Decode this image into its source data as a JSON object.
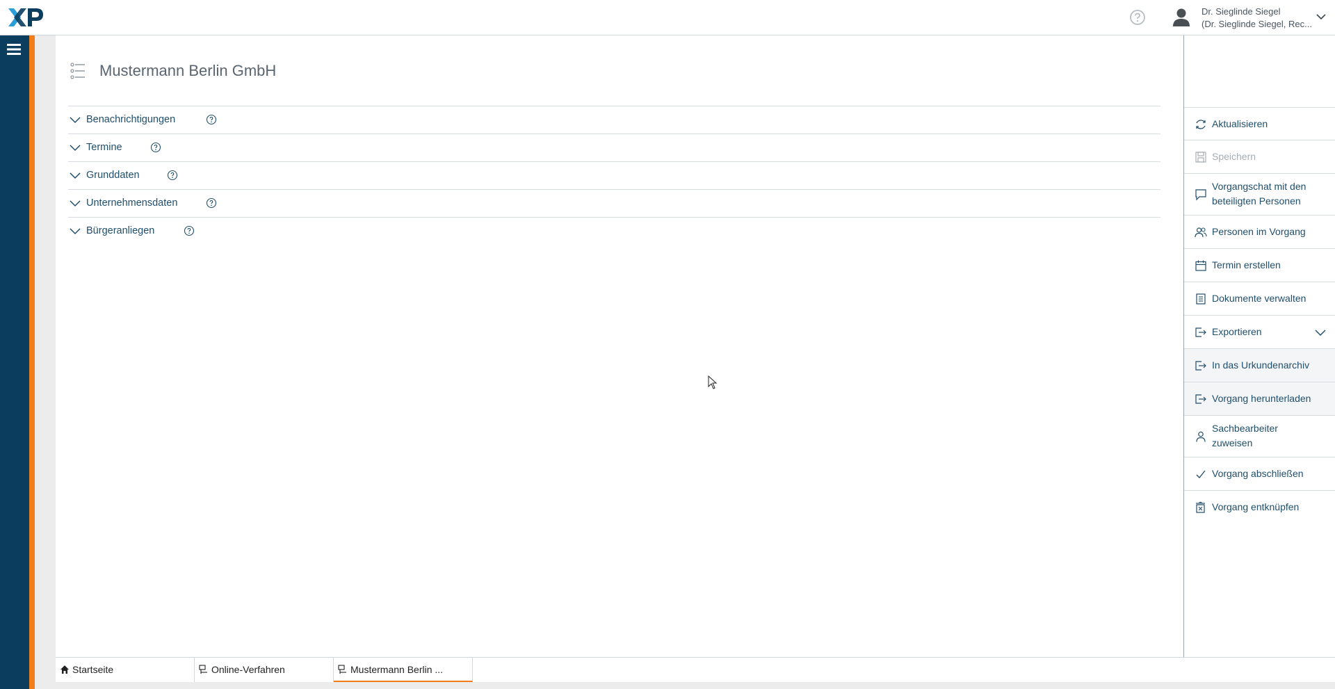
{
  "header": {
    "logo_text": "XP",
    "user_name": "Dr. Sieglinde Siegel",
    "user_role": "(Dr. Sieglinde Siegel, Rec..."
  },
  "main": {
    "title": "Mustermann Berlin GmbH",
    "sections": [
      {
        "label": "Benachrichtigungen"
      },
      {
        "label": "Termine"
      },
      {
        "label": "Grunddaten"
      },
      {
        "label": "Unternehmensdaten"
      },
      {
        "label": "Bürgeranliegen"
      }
    ]
  },
  "actions": {
    "refresh": "Aktualisieren",
    "save": "Speichern",
    "chat_line1": "Vorgangschat mit den",
    "chat_line2": "beteiligten Personen",
    "persons": "Personen im Vorgang",
    "appointment": "Termin erstellen",
    "documents": "Dokumente verwalten",
    "export": "Exportieren",
    "archive": "In das Urkundenarchiv",
    "download": "Vorgang herunterladen",
    "assign_line1": "Sachbearbeiter",
    "assign_line2": "zuweisen",
    "close": "Vorgang abschließen",
    "unlink": "Vorgang entknüpfen"
  },
  "tabs": [
    {
      "label": "Startseite"
    },
    {
      "label": "Online-Verfahren"
    },
    {
      "label": "Mustermann Berlin ..."
    }
  ],
  "colors": {
    "nav": "#0b3d5e",
    "accent": "#f07d1a",
    "link": "#1f4e6b"
  }
}
